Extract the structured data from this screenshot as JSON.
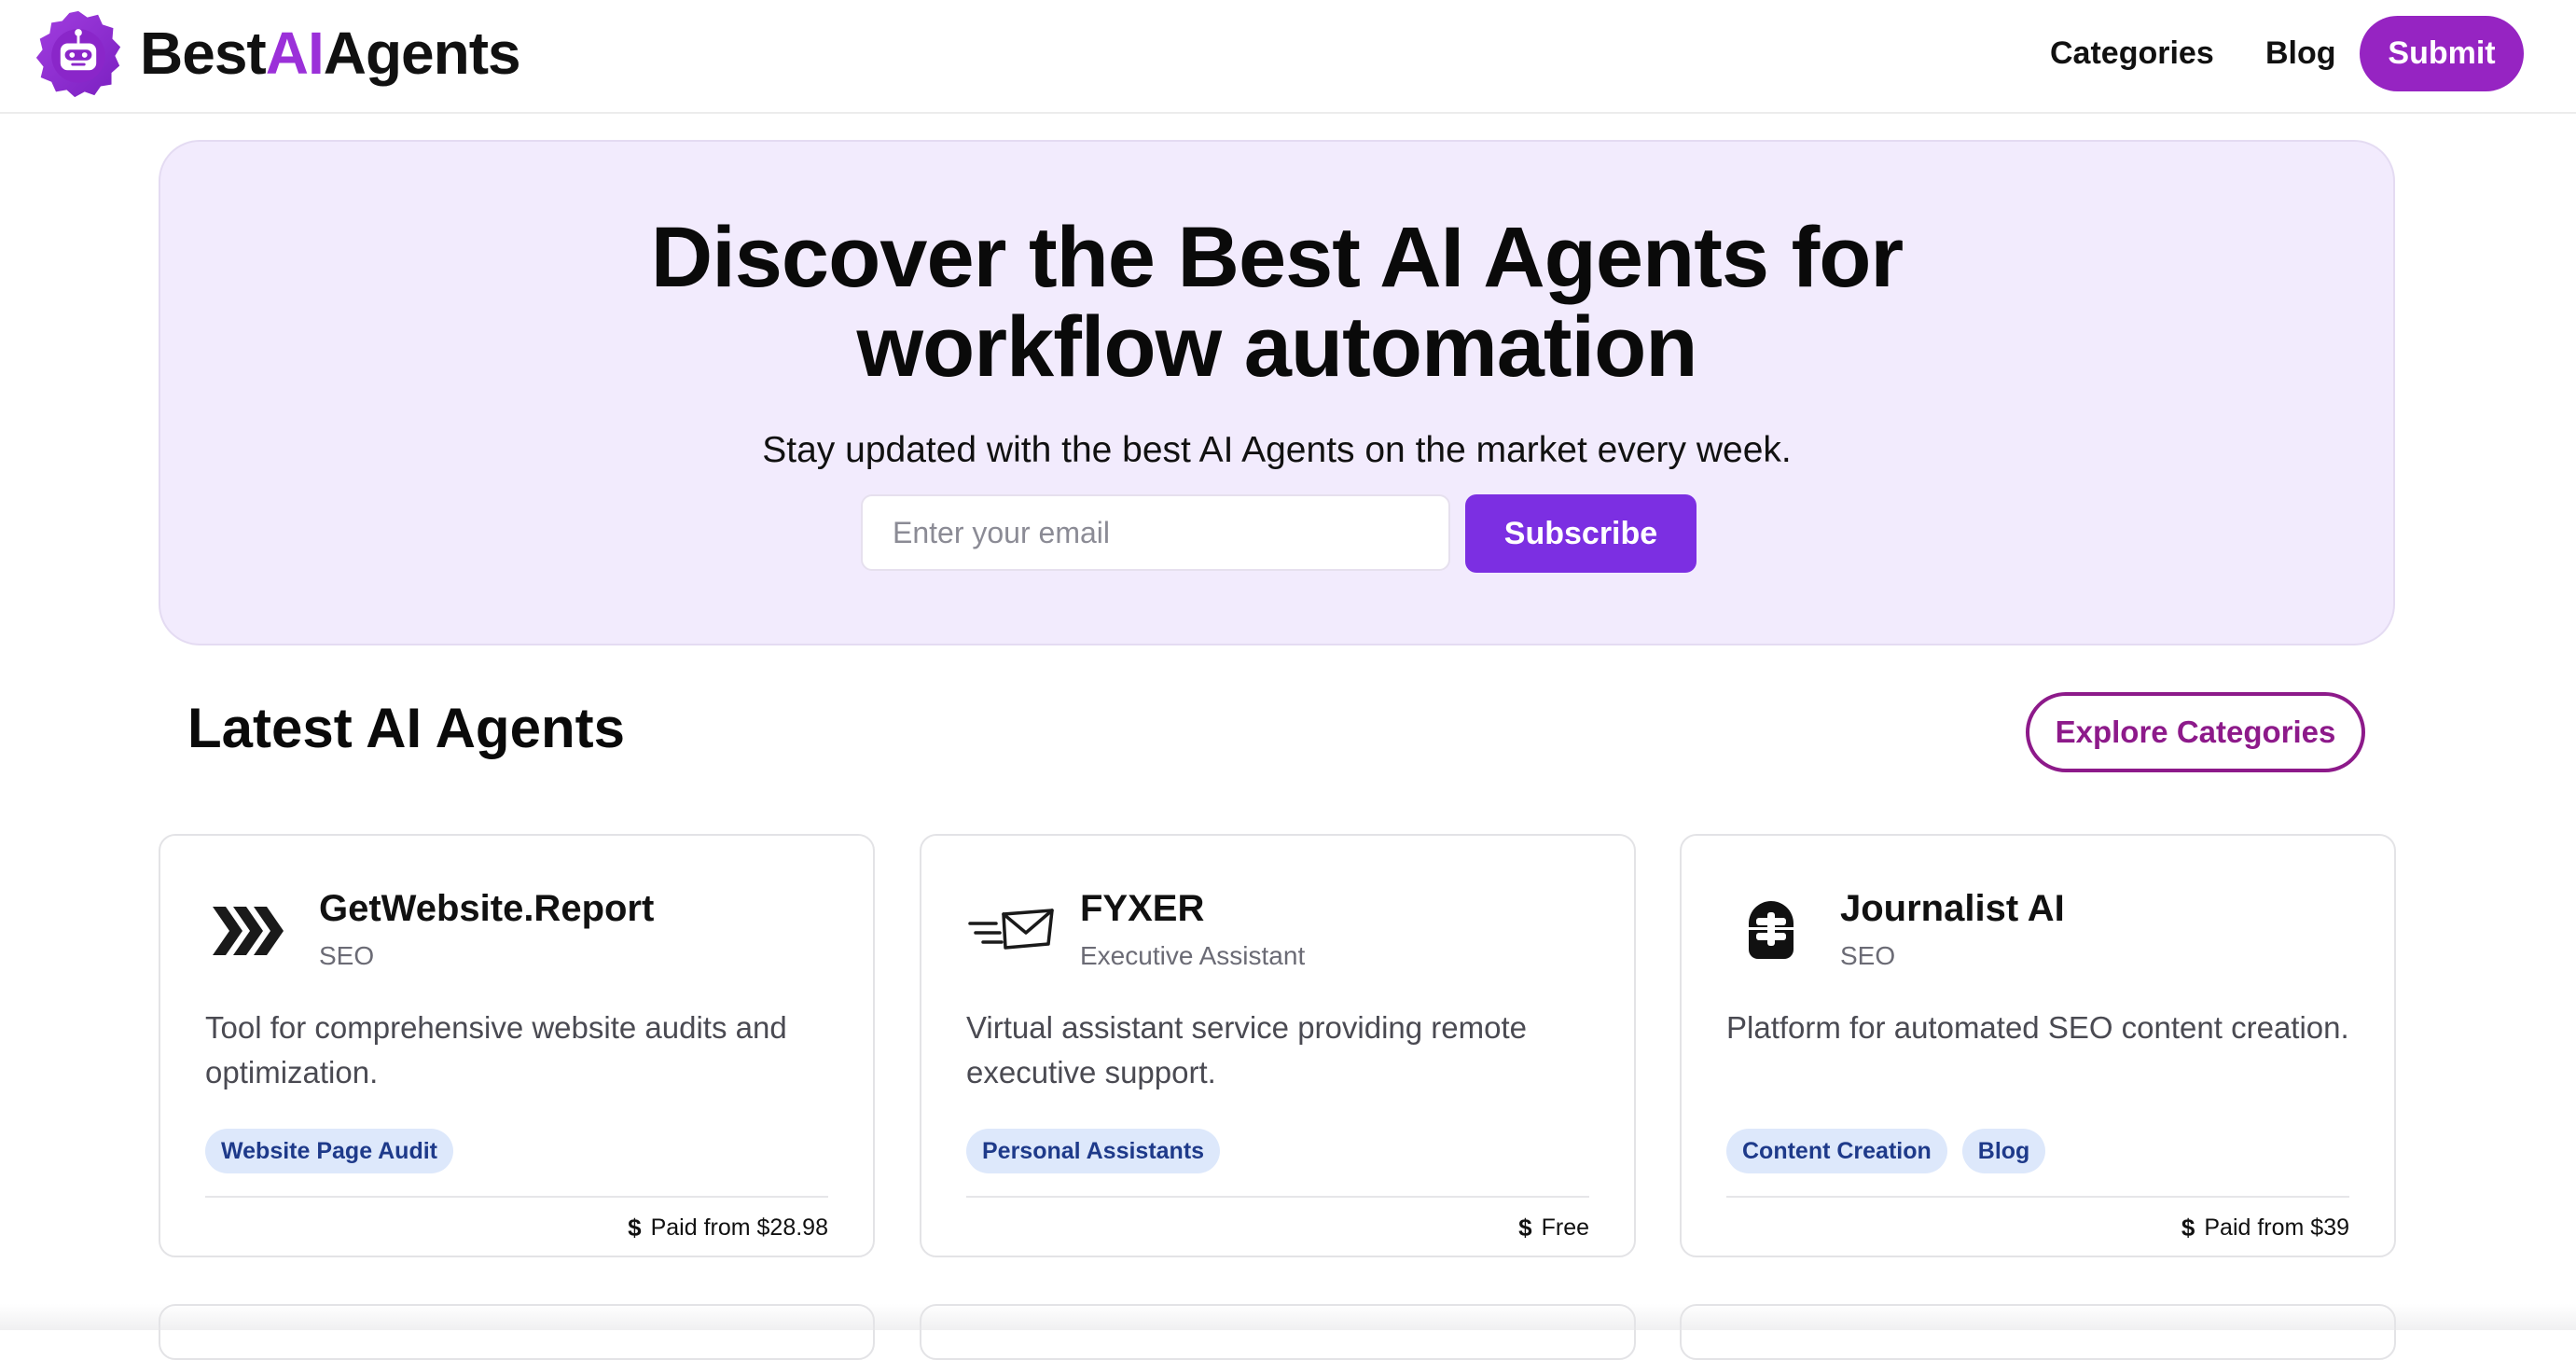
{
  "header": {
    "brand_prefix": "Best",
    "brand_accent": "AI",
    "brand_suffix": "Agents",
    "nav": {
      "categories": "Categories",
      "blog": "Blog"
    },
    "submit_label": "Submit",
    "logo_icon": "robot-badge-icon"
  },
  "hero": {
    "title": "Discover the Best AI Agents for workflow automation",
    "subtitle": "Stay updated with the best AI Agents on the market every week.",
    "email_placeholder": "Enter your email",
    "subscribe_label": "Subscribe"
  },
  "section": {
    "title": "Latest AI Agents",
    "explore_label": "Explore Categories"
  },
  "cards": [
    {
      "name": "GetWebsite.Report",
      "category": "SEO",
      "description": "Tool for comprehensive website audits and optimization.",
      "tags": [
        "Website Page Audit"
      ],
      "price": "Paid from $28.98",
      "icon": "chevrons-icon"
    },
    {
      "name": "FYXER",
      "category": "Executive Assistant",
      "description": "Virtual assistant service providing remote executive support.",
      "tags": [
        "Personal Assistants"
      ],
      "price": "Free",
      "icon": "envelope-icon"
    },
    {
      "name": "Journalist AI",
      "category": "SEO",
      "description": "Platform for automated SEO content creation.",
      "tags": [
        "Content Creation",
        "Blog"
      ],
      "price": "Paid from $39",
      "icon": "journalist-logo-icon"
    }
  ],
  "colors": {
    "brand_purple": "#9b30d9",
    "submit_bg": "#9624c2",
    "hero_bg": "#f2ebfd",
    "subscribe_bg": "#7c2fe2",
    "explore_border": "#8d1a8a",
    "tag_bg": "#dde8fb",
    "tag_text": "#1e3a8a"
  }
}
